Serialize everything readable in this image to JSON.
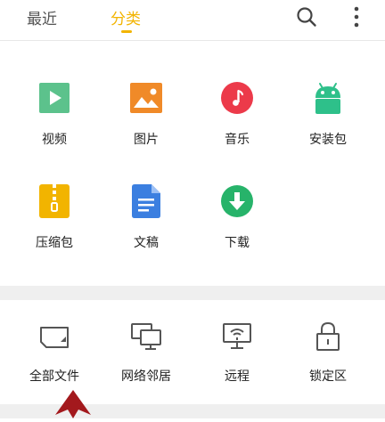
{
  "header": {
    "tabs": [
      {
        "label": "最近",
        "active": false
      },
      {
        "label": "分类",
        "active": true
      }
    ],
    "accent_color": "#f2b400",
    "icons": [
      "search-icon",
      "more-vert-icon"
    ]
  },
  "categories": [
    {
      "label": "视频",
      "icon": "video-icon",
      "color": "#5cc28c"
    },
    {
      "label": "图片",
      "icon": "image-icon",
      "color": "#f08a28"
    },
    {
      "label": "音乐",
      "icon": "music-icon",
      "color": "#ec3a4a"
    },
    {
      "label": "安装包",
      "icon": "android-icon",
      "color": "#2ec08a"
    },
    {
      "label": "压缩包",
      "icon": "zip-icon",
      "color": "#f2b400"
    },
    {
      "label": "文稿",
      "icon": "document-icon",
      "color": "#3b7fe0"
    },
    {
      "label": "下载",
      "icon": "download-icon",
      "color": "#27b36a"
    }
  ],
  "locations": [
    {
      "label": "全部文件",
      "icon": "storage-card-icon"
    },
    {
      "label": "网络邻居",
      "icon": "network-computers-icon"
    },
    {
      "label": "远程",
      "icon": "remote-monitor-icon"
    },
    {
      "label": "锁定区",
      "icon": "lock-icon"
    }
  ]
}
